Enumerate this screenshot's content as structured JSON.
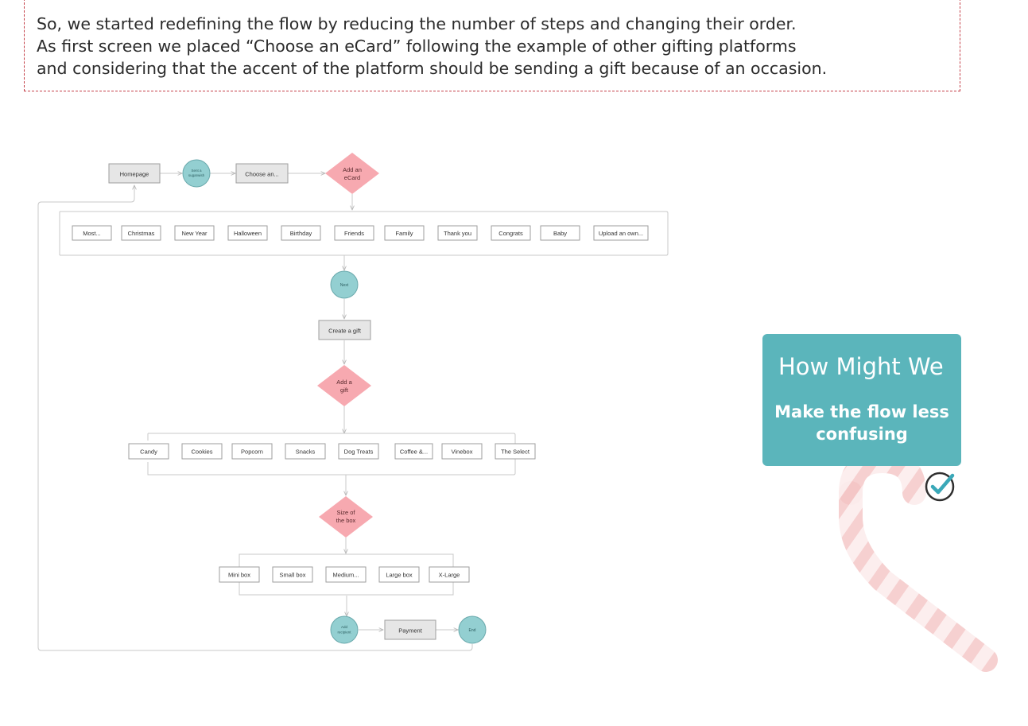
{
  "intro": {
    "lines": [
      "So, we started redefining the flow by reducing the number of steps and changing their order.",
      "As first screen we placed “Choose an eCard” following the example of other gifting platforms",
      "and considering that the accent of the platform should be sending a gift because of an occasion."
    ]
  },
  "flow": {
    "top_row": {
      "homepage": "Homepage",
      "send_wish_lines": [
        "Sent a",
        "sugarwish"
      ],
      "choose": "Choose an...",
      "add_ecard_lines": [
        "Add an",
        "eCard"
      ]
    },
    "ecard_categories": [
      "Most...",
      "Christmas",
      "New Year",
      "Halloween",
      "Birthday",
      "Friends",
      "Family",
      "Thank you",
      "Congrats",
      "Baby",
      "Upload an own..."
    ],
    "next": "Next",
    "create_gift": "Create a gift",
    "add_gift_lines": [
      "Add a",
      "gift"
    ],
    "gift_types": [
      "Candy",
      "Cookies",
      "Popcorn",
      "Snacks",
      "Dog Treats",
      "Coffee &...",
      "Vinebox",
      "The Select"
    ],
    "box_size_lines": [
      "Size of",
      "the box"
    ],
    "box_sizes": [
      "Mini box",
      "Small box",
      "Medium...",
      "Large box",
      "X-Large"
    ],
    "add_recipient_lines": [
      "Add",
      "recipient"
    ],
    "payment": "Payment",
    "end": "End"
  },
  "hmw": {
    "title": "How Might We",
    "body": "Make the flow less confusing"
  },
  "colors": {
    "dashed_border": "#c5424a",
    "teal_node": "#93cfd1",
    "pink_diamond": "#f7a9b0",
    "grey_box": "#e6e6e6",
    "card_teal": "#5bb5bb"
  }
}
